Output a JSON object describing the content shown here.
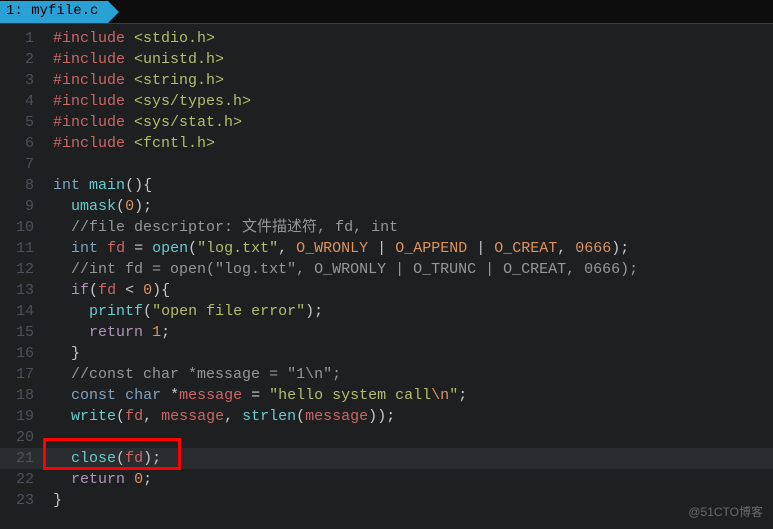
{
  "tab": {
    "label": "1: myfile.c"
  },
  "watermark": "@51CTO博客",
  "lines": {
    "l1": {
      "n": "1"
    },
    "l2": {
      "n": "2"
    },
    "l3": {
      "n": "3"
    },
    "l4": {
      "n": "4"
    },
    "l5": {
      "n": "5"
    },
    "l6": {
      "n": "6"
    },
    "l7": {
      "n": "7"
    },
    "l8": {
      "n": "8"
    },
    "l9": {
      "n": "9"
    },
    "l10": {
      "n": "10"
    },
    "l11": {
      "n": "11"
    },
    "l12": {
      "n": "12"
    },
    "l13": {
      "n": "13"
    },
    "l14": {
      "n": "14"
    },
    "l15": {
      "n": "15"
    },
    "l16": {
      "n": "16"
    },
    "l17": {
      "n": "17"
    },
    "l18": {
      "n": "18"
    },
    "l19": {
      "n": "19"
    },
    "l20": {
      "n": "20"
    },
    "l21": {
      "n": "21"
    },
    "l22": {
      "n": "22"
    },
    "l23": {
      "n": "23"
    }
  },
  "tok": {
    "hash_include": "#include",
    "inc_stdio": " <stdio.h>",
    "inc_unistd": " <unistd.h>",
    "inc_string": " <string.h>",
    "inc_systypes": " <sys/types.h>",
    "inc_sysstat": " <sys/stat.h>",
    "inc_fcntl": " <fcntl.h>",
    "kw_int": "int",
    "kw_const": "const",
    "kw_char": "char",
    "kw_if": "if",
    "kw_return": "return",
    "fn_main": "main",
    "fn_umask": "umask",
    "fn_open": "open",
    "fn_printf": "printf",
    "fn_write": "write",
    "fn_strlen": "strlen",
    "fn_close": "close",
    "id_fd": "fd",
    "id_message": "message",
    "num_0": "0",
    "num_1": "1",
    "num_0666": "0666",
    "str_log": "\"log.txt\"",
    "str_err": "\"open file error\"",
    "str_hello_a": "\"hello system call",
    "str_hello_b": "\"",
    "esc_n": "\\n",
    "m_wronly": "O_WRONLY",
    "m_append": "O_APPEND",
    "m_trunc": "O_TRUNC",
    "m_creat": "O_CREAT",
    "cmt_fd": "//file descriptor: 文件描述符, fd, int",
    "cmt_open": "//int fd = open(\"log.txt\", O_WRONLY | O_TRUNC | O_CREAT, 0666);",
    "cmt_msg": "//const char *message = \"1\\n\";",
    "p_open": "(",
    "p_close": ")",
    "p_ocurly": "{",
    "p_ccurly": "}",
    "p_semi": ";",
    "p_comma": ", ",
    "p_pipe": " | ",
    "p_eq": " = ",
    "p_lt": " < ",
    "p_star": "*",
    "sp1": " ",
    "sp2": "  ",
    "sp4": "    "
  }
}
